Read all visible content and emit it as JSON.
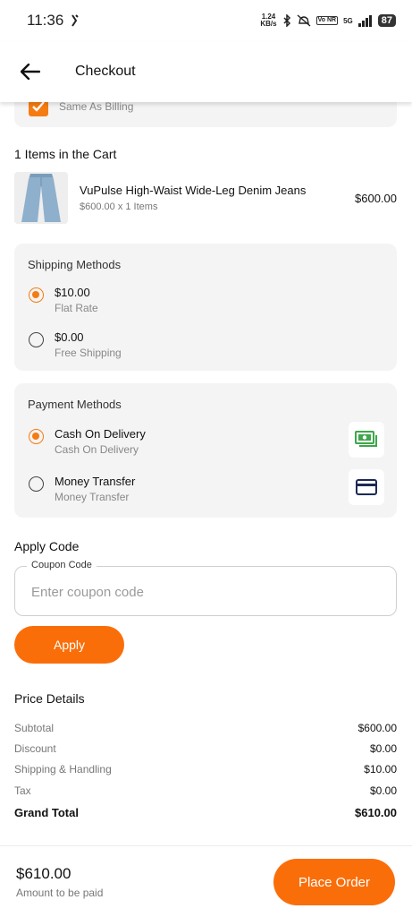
{
  "status_bar": {
    "time": "11:36",
    "net_speed_value": "1.24",
    "net_speed_unit": "KB/s",
    "volte": "Vo NR",
    "signal": "5G",
    "battery": "87"
  },
  "header": {
    "title": "Checkout"
  },
  "billing": {
    "same_as_billing_label": "Same As Billing",
    "checked": true
  },
  "cart": {
    "title": "1 Items in the Cart",
    "items": [
      {
        "name": "VuPulse High-Waist Wide-Leg Denim Jeans",
        "qty_line": "$600.00 x 1 Items",
        "price": "$600.00"
      }
    ]
  },
  "shipping": {
    "title": "Shipping Methods",
    "options": [
      {
        "price": "$10.00",
        "label": "Flat Rate",
        "selected": true
      },
      {
        "price": "$0.00",
        "label": "Free Shipping",
        "selected": false
      }
    ]
  },
  "payment": {
    "title": "Payment Methods",
    "options": [
      {
        "name": "Cash On Delivery",
        "sub": "Cash On Delivery",
        "selected": true,
        "icon": "cash-icon",
        "icon_color": "#3fa64a"
      },
      {
        "name": "Money Transfer",
        "sub": "Money Transfer",
        "selected": false,
        "icon": "credit-card-icon",
        "icon_color": "#1e2a55"
      }
    ]
  },
  "coupon": {
    "title": "Apply Code",
    "label": "Coupon Code",
    "placeholder": "Enter coupon code",
    "value": "",
    "apply_label": "Apply"
  },
  "price_details": {
    "title": "Price Details",
    "rows": [
      {
        "label": "Subtotal",
        "value": "$600.00"
      },
      {
        "label": "Discount",
        "value": "$0.00"
      },
      {
        "label": "Shipping & Handling",
        "value": "$10.00"
      },
      {
        "label": "Tax",
        "value": "$0.00"
      },
      {
        "label": "Grand Total",
        "value": "$610.00"
      }
    ]
  },
  "footer": {
    "amount": "$610.00",
    "amount_label": "Amount to be paid",
    "place_order_label": "Place Order"
  },
  "colors": {
    "accent": "#fa6e0a",
    "panel_bg": "#f4f4f4"
  }
}
